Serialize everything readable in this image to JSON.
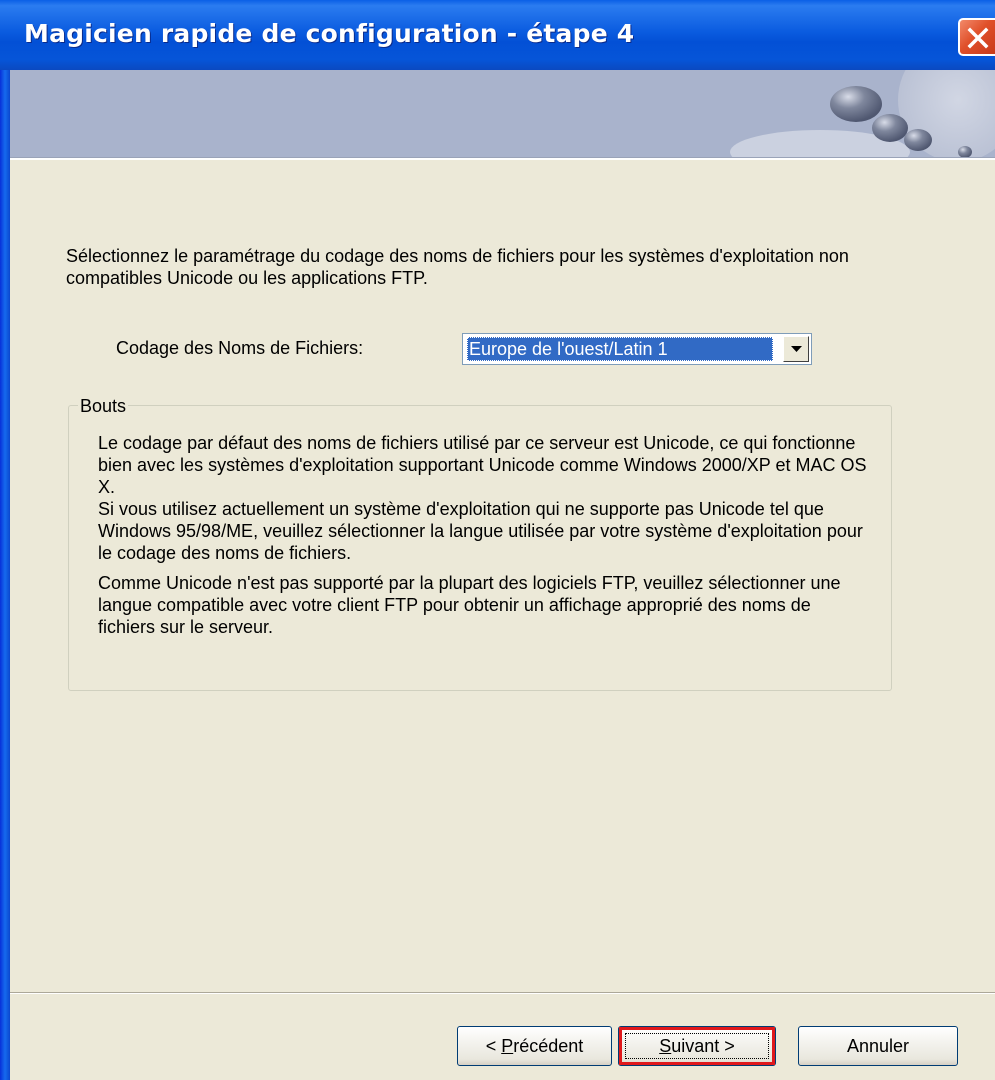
{
  "window": {
    "title": "Magicien rapide de configuration - étape 4"
  },
  "titlebar": {
    "close_icon": "close-icon"
  },
  "banner": {
    "decoration_icon": "decorative-spheres"
  },
  "content": {
    "intro": "Sélectionnez le paramétrage du codage des noms de fichiers pour les systèmes d'exploitation non compatibles Unicode ou les applications FTP.",
    "encoding_label": "Codage des Noms de Fichiers:",
    "encoding_selected": "Europe de l'ouest/Latin 1"
  },
  "tips": {
    "legend": "Bouts",
    "paragraph1": "Le codage par défaut des noms de fichiers utilisé par ce serveur est Unicode, ce qui fonctionne bien avec les systèmes d'exploitation supportant Unicode comme Windows 2000/XP et MAC OS X.",
    "paragraph2": "Si vous utilisez actuellement un système d'exploitation qui ne supporte pas Unicode tel que Windows 95/98/ME, veuillez sélectionner la langue utilisée par votre système d'exploitation pour le codage des noms de fichiers.",
    "paragraph3": "Comme Unicode n'est pas supporté par la plupart des logiciels FTP, veuillez sélectionner une langue compatible avec votre client FTP pour obtenir un affichage approprié des noms de fichiers sur le serveur."
  },
  "buttons": {
    "prev_prefix": "< ",
    "prev_mnemonic": "P",
    "prev_rest": "récédent",
    "next_mnemonic": "S",
    "next_rest": "uivant >",
    "cancel": "Annuler"
  },
  "colors": {
    "titlebar": "#0055e5",
    "dialog_bg": "#ece9d8",
    "selection": "#316ac5",
    "highlight_outline": "#e0191c"
  }
}
